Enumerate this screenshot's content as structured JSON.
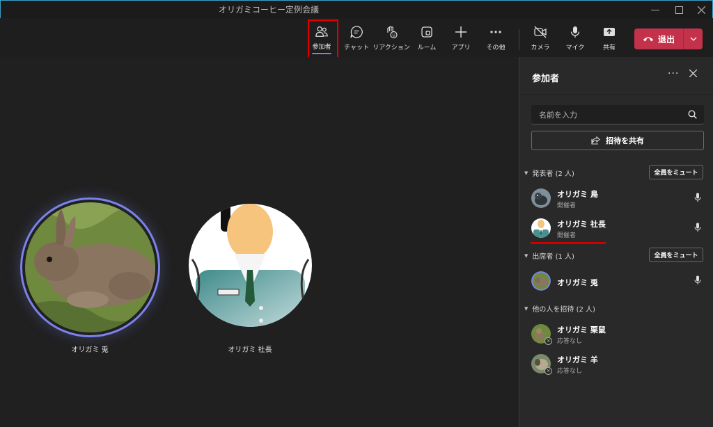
{
  "window": {
    "title": "オリガミコーヒー定例会議"
  },
  "toolbar": {
    "participants": "参加者",
    "chat": "チャット",
    "reactions": "リアクション",
    "rooms": "ルーム",
    "apps": "アプリ",
    "more": "その他",
    "camera": "カメラ",
    "mic": "マイク",
    "share": "共有",
    "leave": "退出"
  },
  "stage": {
    "tiles": [
      {
        "name": "オリガミ 兎"
      },
      {
        "name": "オリガミ 社長"
      }
    ]
  },
  "panel": {
    "title": "参加者",
    "search_placeholder": "名前を入力",
    "invite_label": "招待を共有",
    "mute_all": "全員をミュート",
    "sections": [
      {
        "label": "発表者 (2 人)",
        "people": [
          {
            "name": "オリガミ 鳥",
            "role": "開催者"
          },
          {
            "name": "オリガミ 社長",
            "role": "開催者"
          }
        ]
      },
      {
        "label": "出席者 (1 人)",
        "people": [
          {
            "name": "オリガミ 兎",
            "role": ""
          }
        ]
      },
      {
        "label": "他の人を招待 (2 人)",
        "people": [
          {
            "name": "オリガミ 栗鼠",
            "role": "応答なし"
          },
          {
            "name": "オリガミ 羊",
            "role": "応答なし"
          }
        ]
      }
    ]
  },
  "colors": {
    "accent": "#7b83eb",
    "leave": "#c4314b",
    "highlight": "#e00000"
  }
}
